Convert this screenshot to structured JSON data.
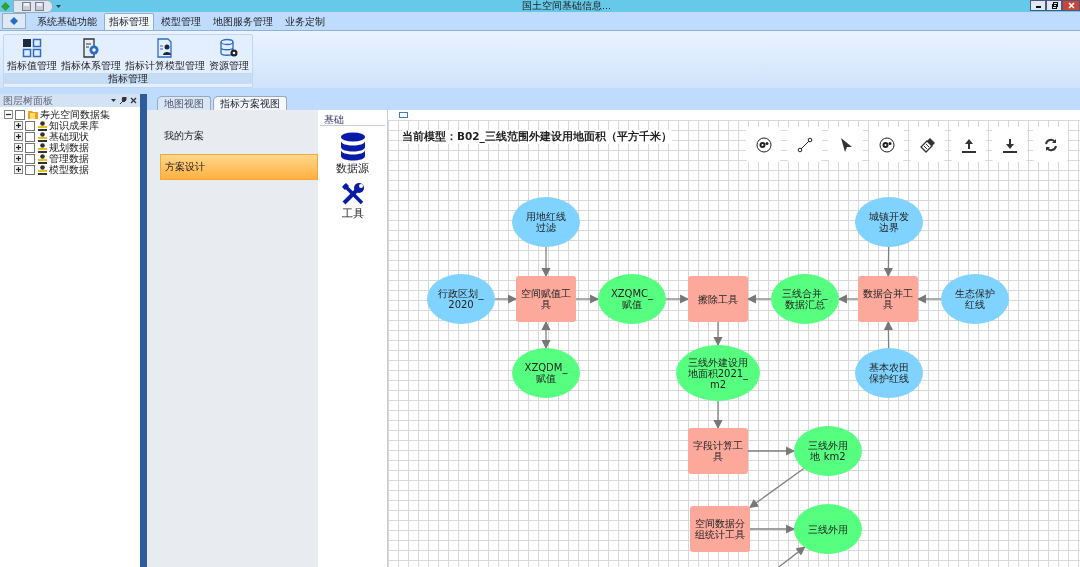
{
  "window": {
    "title": "国土空间基础信息..."
  },
  "menu_tabs": [
    {
      "label": "系统基础功能",
      "selected": false
    },
    {
      "label": "指标管理",
      "selected": true
    },
    {
      "label": "模型管理",
      "selected": false
    },
    {
      "label": "地图服务管理",
      "selected": false
    },
    {
      "label": "业务定制",
      "selected": false
    }
  ],
  "ribbon": {
    "group_label": "指标管理",
    "buttons": [
      {
        "label": "指标值管理",
        "kind": "grid"
      },
      {
        "label": "指标体系管理",
        "kind": "doc-gear"
      },
      {
        "label": "指标计算模型管理",
        "kind": "doc-person"
      },
      {
        "label": "资源管理",
        "kind": "db-gear"
      }
    ]
  },
  "layer_panel": {
    "title": "图层树面板",
    "tree": [
      {
        "label": "寿光空间数据集",
        "checked": false,
        "expanded": true,
        "children": [
          {
            "label": "知识成果库",
            "checked": false,
            "expanded": false
          },
          {
            "label": "基础现状",
            "checked": false,
            "expanded": false
          },
          {
            "label": "规划数据",
            "checked": false,
            "expanded": false
          },
          {
            "label": "管理数据",
            "checked": false,
            "expanded": false
          },
          {
            "label": "模型数据",
            "checked": false,
            "expanded": false
          }
        ]
      }
    ]
  },
  "view_tabs": [
    {
      "label": "地图视图",
      "selected": false
    },
    {
      "label": "指标方案视图",
      "selected": true
    }
  ],
  "plan_menu": [
    {
      "label": "我的方案",
      "selected": false
    },
    {
      "label": "方案设计",
      "selected": true
    }
  ],
  "toolbox": {
    "title": "基础",
    "items": [
      {
        "label": "数据源",
        "kind": "database"
      },
      {
        "label": "工具",
        "kind": "tools"
      }
    ]
  },
  "canvas": {
    "title": "当前模型：B02_三线范围外建设用地面积（平方千米）",
    "nodes": [
      {
        "label": "用地红线过滤",
        "kind": "input"
      },
      {
        "label": "城镇开发边界",
        "kind": "input"
      },
      {
        "label": "行政区划_2020",
        "kind": "input"
      },
      {
        "label": "空间赋值工具",
        "kind": "tool"
      },
      {
        "label": "XZQMC_赋值",
        "kind": "output"
      },
      {
        "label": "擦除工具",
        "kind": "tool"
      },
      {
        "label": "三线合并_数据汇总",
        "kind": "output"
      },
      {
        "label": "数据合并工具",
        "kind": "tool"
      },
      {
        "label": "生态保护红线",
        "kind": "input"
      },
      {
        "label": "XZQDM_赋值",
        "kind": "output"
      },
      {
        "label": "三线外建设用地面积2021_m2",
        "kind": "output"
      },
      {
        "label": "基本农田保护红线",
        "kind": "input"
      },
      {
        "label": "字段计算工具",
        "kind": "tool"
      },
      {
        "label": "三线外用地 km2",
        "kind": "output"
      },
      {
        "label": "空间数据分组统计工具",
        "kind": "tool"
      },
      {
        "label": "三线外用",
        "kind": "output"
      }
    ]
  }
}
